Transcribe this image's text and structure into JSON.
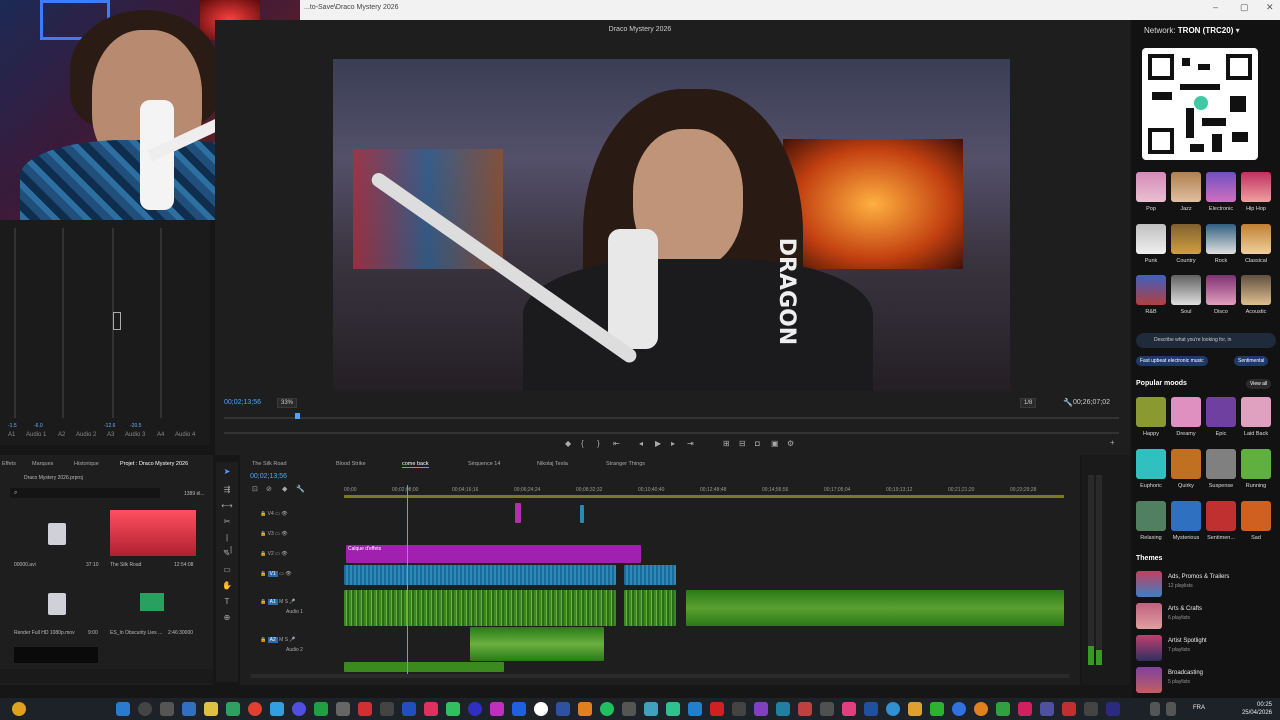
{
  "window": {
    "path": "...to-Save\\Draco Mystery 2026",
    "controls": [
      "–",
      "▢",
      "✕"
    ]
  },
  "program_monitor": {
    "title": "Draco Mystery 2026",
    "timecode": "00;02;13;56",
    "zoom": "33%",
    "resolution": "1/8",
    "duration": "00;26;07;02",
    "video_text": "DRAGON"
  },
  "meters": {
    "labels": [
      "A1",
      "Audio 1",
      "A2",
      "Audio 2",
      "A3",
      "Audio 3",
      "A4",
      "Audio 4"
    ],
    "values": [
      "-1.5",
      "-6.0",
      "-12.6",
      "-20.5"
    ]
  },
  "right_panel": {
    "network_label": "Network:",
    "network_value": "TRON (TRC20)",
    "moods_row1": [
      "Pop",
      "Jazz",
      "Electronic",
      "Hip Hop"
    ],
    "moods_row2": [
      "Punk",
      "Country",
      "Rock",
      "Classical"
    ],
    "moods_row3": [
      "R&B",
      "Soul",
      "Disco",
      "Acoustic"
    ],
    "search_placeholder": "Describe what you're looking for, in",
    "chip1": "Fast upbeat electronic music",
    "chip2": "Sentimental",
    "popular_moods_title": "Popular moods",
    "view_all": "View all",
    "pop_moods_row1": [
      "Happy",
      "Dreamy",
      "Epic",
      "Laid Back"
    ],
    "pop_moods_row2": [
      "Euphoric",
      "Quirky",
      "Suspense",
      "Running"
    ],
    "pop_moods_row3": [
      "Relaxing",
      "Mysterious",
      "Sentimen...",
      "Sad"
    ],
    "themes_title": "Themes",
    "themes": [
      {
        "title": "Ads, Promos & Trailers",
        "sub": "12 playlists"
      },
      {
        "title": "Arts & Crafts",
        "sub": "6 playlists"
      },
      {
        "title": "Artist Spotlight",
        "sub": "7 playlists"
      },
      {
        "title": "Broadcasting",
        "sub": "5 playlists"
      }
    ]
  },
  "project": {
    "tabs": [
      "Effets",
      "Marques",
      "Historique",
      "Projet : Draco Mystery 2026"
    ],
    "file": "Draco Mystery 2026.prproj",
    "count": "1389 él...",
    "items": [
      {
        "name": "00000.avi",
        "dur": "37:10"
      },
      {
        "name": "The Silk Road",
        "dur": "12:54:08"
      },
      {
        "name": "Render Full HD 1080p.mov",
        "dur": "9:00"
      },
      {
        "name": "ES_In Obscurity Lies ...",
        "dur": "2:46:30000"
      }
    ]
  },
  "timeline": {
    "tabs": [
      "The Silk Road",
      "Blood Strike",
      "come back",
      "Séquence 14",
      "Nikolaj Tesla",
      "Stranger Things"
    ],
    "timecode": "00;02;13;56",
    "ruler": [
      "00;00",
      "00;02;08;00",
      "00;04;16;16",
      "00;06;24;24",
      "00;08;32;32",
      "00;10;40;40",
      "00;12;48;48",
      "00;14;56;56",
      "00;17;05;04",
      "00;19;13;12",
      "00;21;21;20",
      "00;23;29;28"
    ],
    "tracks": [
      "V4",
      "V3",
      "V2",
      "V1",
      "A1",
      "A2"
    ],
    "track_names": [
      "Audio 1",
      "Audio 2"
    ],
    "clip_label": "Calque d'effets"
  },
  "taskbar": {
    "lang": "FRA",
    "time": "00:25",
    "date": "25/04/2026"
  }
}
